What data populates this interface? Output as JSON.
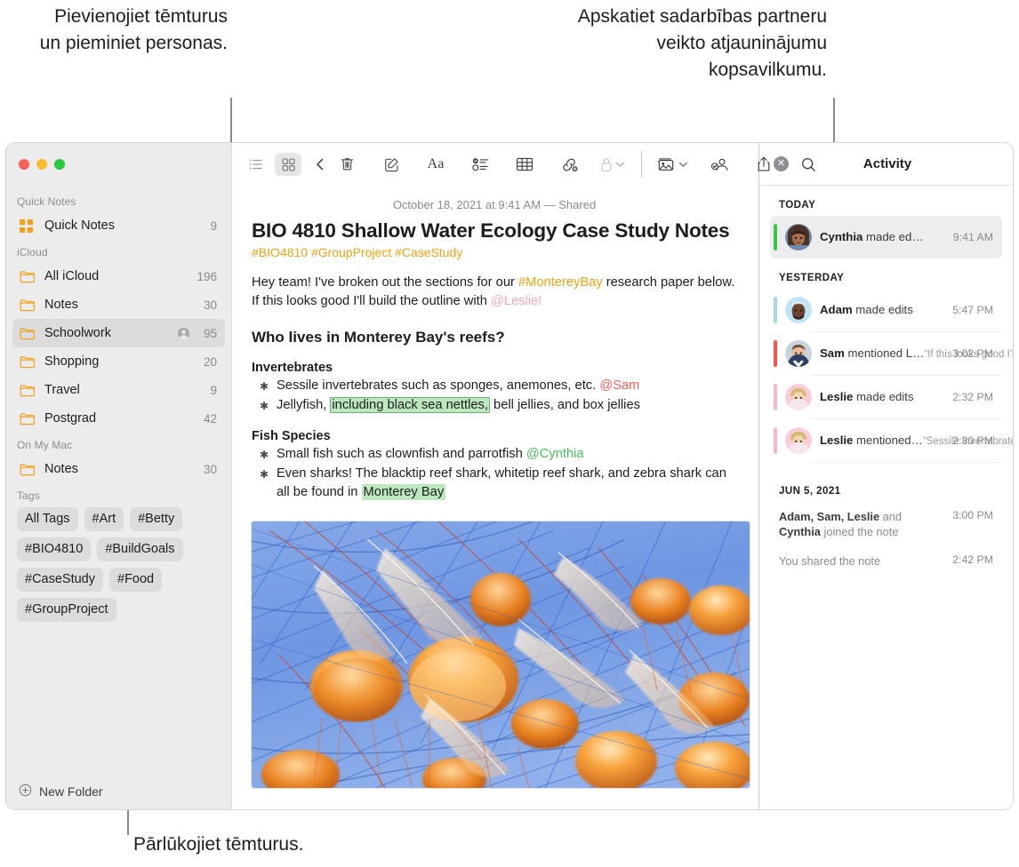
{
  "callouts": {
    "left": "Pievienojiet tēmturus un pieminiet personas.",
    "right": "Apskatiet sadarbības partneru veikto atjauninājumu kopsavilkumu.",
    "bottom": "Pārlūkojiet tēmturus."
  },
  "sidebar": {
    "sections": [
      {
        "header": "Quick Notes",
        "items": [
          {
            "icon": "quicknote-grid-icon",
            "label": "Quick Notes",
            "count": "9",
            "selected": false,
            "shared": false
          }
        ]
      },
      {
        "header": "iCloud",
        "items": [
          {
            "icon": "folder-icon",
            "label": "All iCloud",
            "count": "196",
            "selected": false,
            "shared": false
          },
          {
            "icon": "folder-icon",
            "label": "Notes",
            "count": "30",
            "selected": false,
            "shared": false
          },
          {
            "icon": "folder-icon",
            "label": "Schoolwork",
            "count": "95",
            "selected": true,
            "shared": true
          },
          {
            "icon": "folder-icon",
            "label": "Shopping",
            "count": "20",
            "selected": false,
            "shared": false
          },
          {
            "icon": "folder-icon",
            "label": "Travel",
            "count": "9",
            "selected": false,
            "shared": false
          },
          {
            "icon": "folder-icon",
            "label": "Postgrad",
            "count": "42",
            "selected": false,
            "shared": false
          }
        ]
      },
      {
        "header": "On My Mac",
        "items": [
          {
            "icon": "folder-icon",
            "label": "Notes",
            "count": "30",
            "selected": false,
            "shared": false
          }
        ]
      }
    ],
    "tags_header": "Tags",
    "tags": [
      "All Tags",
      "#Art",
      "#Betty",
      "#BIO4810",
      "#BuildGoals",
      "#CaseStudy",
      "#Food",
      "#GroupProject"
    ],
    "new_folder_label": "New Folder"
  },
  "toolbar": {
    "left": [
      {
        "name": "list-view-icon",
        "active": false
      },
      {
        "name": "gallery-view-icon",
        "active": true
      },
      {
        "name": "back-chevron-icon",
        "active": false
      }
    ],
    "right": [
      {
        "name": "trash-icon"
      },
      {
        "name": "compose-note-icon"
      },
      {
        "name": "format-aa-icon"
      },
      {
        "name": "checklist-icon"
      },
      {
        "name": "table-icon"
      },
      {
        "name": "add-link-icon"
      },
      {
        "name": "lock-icon"
      },
      {
        "name": "media-icon"
      },
      {
        "name": "share-participants-icon"
      },
      {
        "name": "share-icon"
      },
      {
        "name": "search-icon"
      }
    ]
  },
  "note": {
    "date": "October 18, 2021 at 9:41 AM — Shared",
    "title": "BIO 4810 Shallow Water Ecology Case Study Notes",
    "tags": "#BIO4810 #GroupProject #CaseStudy",
    "intro": {
      "part1": "Hey team! I've broken out the sections for our ",
      "hashtag": "#MontereyBay",
      "part2": " research paper below. If this looks good I'll build the outline with ",
      "mention": "@Leslie!"
    },
    "heading": "Who lives in Monterey Bay's reefs?",
    "sections": [
      {
        "subheading": "Invertebrates",
        "bullets": [
          {
            "part1": "Sessile invertebrates such as sponges, anemones, etc. ",
            "mention": "@Sam",
            "mention_color": "red",
            "part2": ""
          },
          {
            "part1": "Jellyfish, ",
            "highlight_boxed": "including black sea nettles,",
            "part2": " bell jellies, and box jellies"
          }
        ]
      },
      {
        "subheading": "Fish Species",
        "bullets": [
          {
            "part1": "Small fish such as clownfish and parrotfish ",
            "mention": "@Cynthia",
            "mention_color": "green",
            "part2": ""
          },
          {
            "part1": "Even sharks! The blacktip reef shark, whitetip reef shark, and zebra shark can all be found in ",
            "highlight": "Monterey Bay",
            "part2": ""
          }
        ]
      }
    ],
    "image_alt": "jellyfish-photo"
  },
  "activity": {
    "title": "Activity",
    "close_icon": "close-icon",
    "groups": [
      {
        "label": "TODAY",
        "items": [
          {
            "name": "Cynthia",
            "action": " made ed…",
            "time": "9:41 AM",
            "quote": "",
            "bar": "#3bc34a",
            "avatar": "cynthia-avatar",
            "highlight": true,
            "separator": false
          }
        ]
      },
      {
        "label": "YESTERDAY",
        "items": [
          {
            "name": "Adam",
            "action": " made edits",
            "time": "5:47 PM",
            "quote": "",
            "bar": "#a8d8f0",
            "avatar": "adam-avatar",
            "highlight": false,
            "separator": true
          },
          {
            "name": "Sam",
            "action": " mentioned L…",
            "time": "3:02 PM",
            "quote": "“If this looks good I'll…",
            "bar": "#f4554a",
            "avatar": "sam-avatar",
            "highlight": false,
            "separator": true
          },
          {
            "name": "Leslie",
            "action": " made edits",
            "time": "2:32 PM",
            "quote": "",
            "bar": "#f7b8cd",
            "avatar": "leslie-avatar",
            "highlight": false,
            "separator": true
          },
          {
            "name": "Leslie",
            "action": " mentioned…",
            "time": "2:30 PM",
            "quote": "“Sessile invertebrates…",
            "bar": "#f7b8cd",
            "avatar": "leslie-avatar",
            "highlight": false,
            "separator": true
          }
        ]
      }
    ],
    "footer_group": {
      "label": "JUN 5, 2021",
      "rows": [
        {
          "bold1": "Adam, Sam, Leslie",
          "mid": " and ",
          "bold2": "Cynthia",
          "tail": " joined the note",
          "time": "3:00 PM"
        },
        {
          "bold1": "",
          "mid": "You shared the note",
          "bold2": "",
          "tail": "",
          "time": "2:42 PM"
        }
      ]
    }
  },
  "colors": {
    "accent_orange": "#e8a317",
    "highlight_green": "#bbe8bd",
    "selection_gray": "#dcdcdc"
  }
}
